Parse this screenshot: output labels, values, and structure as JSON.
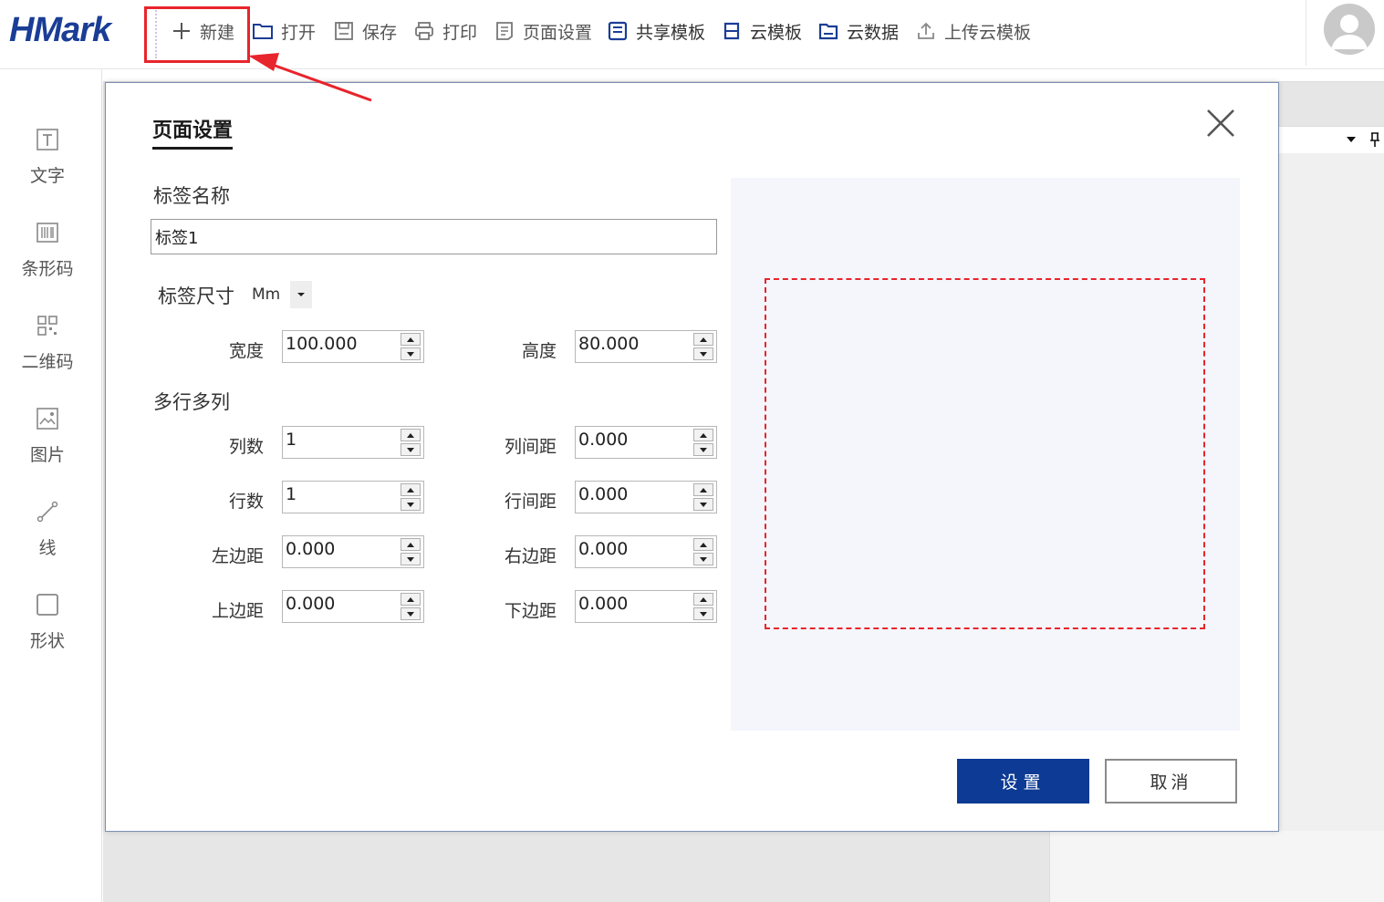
{
  "app": {
    "logo": "HMark"
  },
  "toolbar": {
    "items": [
      {
        "label": "新建",
        "icon": "plus-icon"
      },
      {
        "label": "打开",
        "icon": "folder-icon"
      },
      {
        "label": "保存",
        "icon": "save-icon"
      },
      {
        "label": "打印",
        "icon": "printer-icon"
      },
      {
        "label": "页面设置",
        "icon": "page-settings-icon"
      },
      {
        "label": "共享模板",
        "icon": "share-template-icon"
      },
      {
        "label": "云模板",
        "icon": "cloud-template-icon"
      },
      {
        "label": "云数据",
        "icon": "cloud-data-icon"
      },
      {
        "label": "上传云模板",
        "icon": "upload-icon"
      }
    ]
  },
  "tools": [
    {
      "label": "文字",
      "icon": "text-icon"
    },
    {
      "label": "条形码",
      "icon": "barcode-icon"
    },
    {
      "label": "二维码",
      "icon": "qrcode-icon"
    },
    {
      "label": "图片",
      "icon": "image-icon"
    },
    {
      "label": "线",
      "icon": "line-icon"
    },
    {
      "label": "形状",
      "icon": "shape-icon"
    }
  ],
  "dialog": {
    "title": "页面设置",
    "name_label": "标签名称",
    "name_value": "标签1",
    "size_label": "标签尺寸",
    "unit": "Mm",
    "width_label": "宽度",
    "width_value": "100.000",
    "height_label": "高度",
    "height_value": "80.000",
    "multi_label": "多行多列",
    "cols_label": "列数",
    "cols_value": "1",
    "col_gap_label": "列间距",
    "col_gap_value": "0.000",
    "rows_label": "行数",
    "rows_value": "1",
    "row_gap_label": "行间距",
    "row_gap_value": "0.000",
    "left_margin_label": "左边距",
    "left_margin_value": "0.000",
    "right_margin_label": "右边距",
    "right_margin_value": "0.000",
    "top_margin_label": "上边距",
    "top_margin_value": "0.000",
    "bottom_margin_label": "下边距",
    "bottom_margin_value": "0.000",
    "set_button": "设置",
    "cancel_button": "取消"
  },
  "colors": {
    "logo": "#1a3d96",
    "primary_button": "#0c3a94",
    "highlight": "#e8242c"
  }
}
